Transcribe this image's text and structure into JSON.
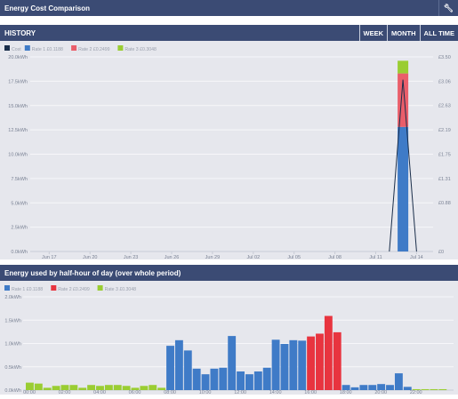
{
  "title": "Energy Cost Comparison",
  "history": {
    "title": "HISTORY",
    "range_buttons": [
      "WEEK",
      "MONTH",
      "ALL TIME"
    ]
  },
  "halfhour": {
    "title": "Energy used by half-hour of day (over whole period)"
  },
  "colors": {
    "header_bg": "#3b4b74",
    "rate1": "#3f7bc7",
    "rate2": "#ea5e6a",
    "rate2_peak": "#e8343f",
    "rate3": "#9acd32",
    "cost_line": "#1a2e4a",
    "panel_bg": "#e6e7ed"
  },
  "chart_data": [
    {
      "type": "bar",
      "title": "",
      "legend_position": "top-left",
      "legend": [
        "Cost",
        "Rate 1 £0.1188",
        "Rate 2 £0.2499",
        "Rate 3 £0.3048"
      ],
      "x_tick_labels": [
        "Jun 17",
        "Jun 20",
        "Jun 23",
        "Jun 26",
        "Jun 29",
        "Jul 02",
        "Jul 05",
        "Jul 08",
        "Jul 11",
        "Jul 14"
      ],
      "y_left_ticks": [
        "0.0kWh",
        "2.5kWh",
        "5.0kWh",
        "7.5kWh",
        "10.0kWh",
        "12.5kWh",
        "15.0kWh",
        "17.5kWh",
        "20.0kWh"
      ],
      "y_right_ticks": [
        "£0",
        "£0.88",
        "£1.31",
        "£1.75",
        "£2.19",
        "£2.63",
        "£3.06",
        "£3.50"
      ],
      "ylim_kwh": [
        0,
        20
      ],
      "ylim_cost": [
        0,
        3.5
      ],
      "series": [
        {
          "name": "Rate 1 £0.1188",
          "x": [
            "Jul 13"
          ],
          "values": [
            12.8
          ]
        },
        {
          "name": "Rate 2 £0.2499",
          "x": [
            "Jul 13"
          ],
          "values": [
            5.5
          ]
        },
        {
          "name": "Rate 3 £0.3048",
          "x": [
            "Jul 13"
          ],
          "values": [
            1.3
          ]
        }
      ],
      "cost_line": {
        "name": "Cost",
        "x": [
          "Jul 12",
          "Jul 13",
          "Jul 14"
        ],
        "values": [
          0,
          3.09,
          0
        ]
      },
      "grid": true
    },
    {
      "type": "bar",
      "title": "",
      "legend_position": "top-left",
      "legend": [
        "Rate 1 £0.1188",
        "Rate 2 £0.2499",
        "Rate 3 £0.3048"
      ],
      "x_tick_labels": [
        "00:00",
        "02:00",
        "04:00",
        "06:00",
        "08:00",
        "10:00",
        "12:00",
        "14:00",
        "16:00",
        "18:00",
        "20:00",
        "22:00"
      ],
      "y_ticks": [
        "0.0kWh",
        "0.5kWh",
        "1.0kWh",
        "1.5kWh",
        "2.0kWh"
      ],
      "ylim": [
        0,
        2
      ],
      "bars": [
        {
          "rate": 3,
          "value": 0.16
        },
        {
          "rate": 3,
          "value": 0.14
        },
        {
          "rate": 3,
          "value": 0.05
        },
        {
          "rate": 3,
          "value": 0.09
        },
        {
          "rate": 3,
          "value": 0.11
        },
        {
          "rate": 3,
          "value": 0.11
        },
        {
          "rate": 3,
          "value": 0.05
        },
        {
          "rate": 3,
          "value": 0.11
        },
        {
          "rate": 3,
          "value": 0.09
        },
        {
          "rate": 3,
          "value": 0.11
        },
        {
          "rate": 3,
          "value": 0.11
        },
        {
          "rate": 3,
          "value": 0.09
        },
        {
          "rate": 3,
          "value": 0.05
        },
        {
          "rate": 3,
          "value": 0.09
        },
        {
          "rate": 3,
          "value": 0.11
        },
        {
          "rate": 3,
          "value": 0.05
        },
        {
          "rate": 1,
          "value": 0.95
        },
        {
          "rate": 1,
          "value": 1.07
        },
        {
          "rate": 1,
          "value": 0.85
        },
        {
          "rate": 1,
          "value": 0.46
        },
        {
          "rate": 1,
          "value": 0.34
        },
        {
          "rate": 1,
          "value": 0.46
        },
        {
          "rate": 1,
          "value": 0.48
        },
        {
          "rate": 1,
          "value": 1.16
        },
        {
          "rate": 1,
          "value": 0.4
        },
        {
          "rate": 1,
          "value": 0.34
        },
        {
          "rate": 1,
          "value": 0.4
        },
        {
          "rate": 1,
          "value": 0.48
        },
        {
          "rate": 1,
          "value": 1.08
        },
        {
          "rate": 1,
          "value": 0.99
        },
        {
          "rate": 1,
          "value": 1.07
        },
        {
          "rate": 1,
          "value": 1.06
        },
        {
          "rate": 2,
          "value": 1.15
        },
        {
          "rate": 2,
          "value": 1.21
        },
        {
          "rate": 2,
          "value": 1.59
        },
        {
          "rate": 2,
          "value": 1.24
        },
        {
          "rate": 1,
          "value": 0.11
        },
        {
          "rate": 1,
          "value": 0.06
        },
        {
          "rate": 1,
          "value": 0.11
        },
        {
          "rate": 1,
          "value": 0.11
        },
        {
          "rate": 1,
          "value": 0.13
        },
        {
          "rate": 1,
          "value": 0.11
        },
        {
          "rate": 1,
          "value": 0.36
        },
        {
          "rate": 1,
          "value": 0.07
        },
        {
          "rate": 3,
          "value": 0.02
        },
        {
          "rate": 3,
          "value": 0.02
        },
        {
          "rate": 3,
          "value": 0.02
        },
        {
          "rate": 3,
          "value": 0.02
        }
      ],
      "grid": true
    }
  ]
}
